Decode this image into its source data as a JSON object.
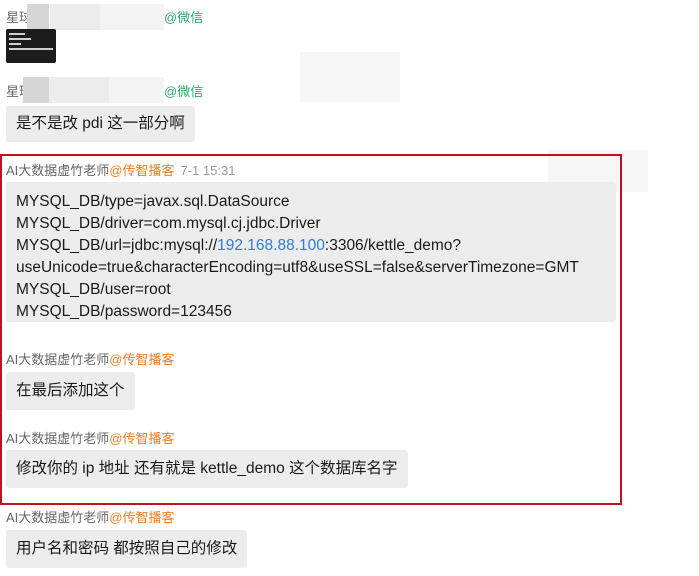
{
  "messages": [
    {
      "sender_prefix": "星球",
      "sender_suffix": "@微信",
      "type": "image"
    },
    {
      "sender_prefix": "星球",
      "sender_suffix": "@微信",
      "text": "是不是改 pdi 这一部分啊"
    },
    {
      "sender": "AI大数据虚竹老师",
      "org": "@传智播客",
      "time": "7-1 15:31",
      "lines": [
        "MYSQL_DB/type=javax.sql.DataSource",
        "MYSQL_DB/driver=com.mysql.cj.jdbc.Driver",
        "MYSQL_DB/password=123456"
      ],
      "url_prefix": "MYSQL_DB/url=jdbc:mysql://",
      "url_ip": "192.168.88.100",
      "url_suffix": ":3306/kettle_demo?",
      "url_params": "useUnicode=true&characterEncoding=utf8&useSSL=false&serverTimezone=GMT",
      "user_line": "MYSQL_DB/user=root"
    },
    {
      "sender": "AI大数据虚竹老师",
      "org": "@传智播客",
      "text": "在最后添加这个"
    },
    {
      "sender": "AI大数据虚竹老师",
      "org": "@传智播客",
      "text": "修改你的 ip 地址  还有就是 kettle_demo 这个数据库名字"
    },
    {
      "sender": "AI大数据虚竹老师",
      "org": "@传智播客",
      "text": "用户名和密码 都按照自己的修改"
    }
  ],
  "colors": {
    "highlight": "#c0111a",
    "org": "#f07c24",
    "wechat": "#2aae67",
    "link": "#2f7fd6",
    "bubble": "#ececec"
  }
}
